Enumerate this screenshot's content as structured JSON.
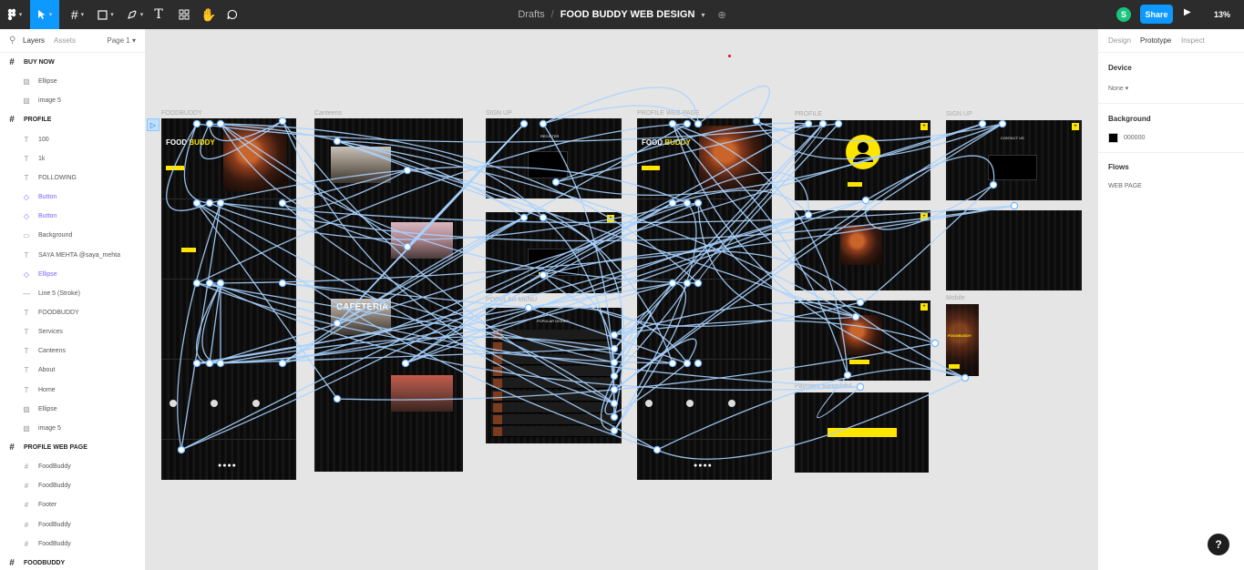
{
  "toolbar": {
    "tools": [
      {
        "name": "main-menu",
        "icon": "figma-logo-icon"
      },
      {
        "name": "move",
        "icon": "move-cursor-icon"
      },
      {
        "name": "frame",
        "icon": "frame-hash-icon"
      },
      {
        "name": "shape",
        "icon": "rectangle-icon"
      },
      {
        "name": "pen",
        "icon": "pen-icon"
      },
      {
        "name": "text",
        "icon": "text-icon"
      },
      {
        "name": "resources",
        "icon": "resources-icon"
      },
      {
        "name": "hand",
        "icon": "hand-icon"
      },
      {
        "name": "comment",
        "icon": "comment-icon"
      }
    ],
    "breadcrumb_parent": "Drafts",
    "separator": "/",
    "file_name": "FOOD BUDDY WEB DESIGN",
    "avatar_initial": "S",
    "share_label": "Share",
    "zoom": "13%"
  },
  "left_panel": {
    "tab_layers": "Layers",
    "tab_assets": "Assets",
    "page": "Page 1",
    "layers": [
      {
        "label": "BUY NOW",
        "kind": "frame"
      },
      {
        "label": "Ellipse",
        "kind": "image"
      },
      {
        "label": "image 5",
        "kind": "image"
      },
      {
        "label": "PROFILE",
        "kind": "frame"
      },
      {
        "label": "100",
        "kind": "text"
      },
      {
        "label": "1k",
        "kind": "text"
      },
      {
        "label": "FOLLOWING",
        "kind": "text"
      },
      {
        "label": "Button",
        "kind": "component"
      },
      {
        "label": "Button",
        "kind": "component"
      },
      {
        "label": "Background",
        "kind": "rect"
      },
      {
        "label": "SAYA MEHTA @saya_mehta",
        "kind": "text"
      },
      {
        "label": "Ellipse",
        "kind": "component"
      },
      {
        "label": "Line 5 (Stroke)",
        "kind": "line"
      },
      {
        "label": "FOODBUDDY",
        "kind": "text"
      },
      {
        "label": "Services",
        "kind": "text"
      },
      {
        "label": "Canteens",
        "kind": "text"
      },
      {
        "label": "About",
        "kind": "text"
      },
      {
        "label": "Home",
        "kind": "text"
      },
      {
        "label": "Ellipse",
        "kind": "image"
      },
      {
        "label": "image 5",
        "kind": "image"
      },
      {
        "label": "PROFILE WEB PAGE",
        "kind": "frame"
      },
      {
        "label": "FoodBuddy",
        "kind": "subframe"
      },
      {
        "label": "FoodBuddy",
        "kind": "subframe"
      },
      {
        "label": "Footer",
        "kind": "subframe"
      },
      {
        "label": "FoodBuddy",
        "kind": "subframe"
      },
      {
        "label": "FoodBuddy",
        "kind": "subframe"
      },
      {
        "label": "FOODBUDDY",
        "kind": "frame"
      }
    ]
  },
  "canvas": {
    "frame_labels": [
      "FOODBUDDY",
      "Canteens",
      "SIGN UP",
      "PROFILE WEB PAGE",
      "PROFILE",
      "SIGN UP",
      "POPULAR MENU",
      "Mobile",
      "Payment successful"
    ],
    "art_text": {
      "food": "FOOD",
      "buddy": "BUDDY",
      "foodbuddy_mobile": "FOODBUDDY",
      "register": "REGISTER",
      "contact": "CONTACT US",
      "popular": "POPULAR DISHES",
      "cafeteria": "CAFETERIA"
    }
  },
  "right_panel": {
    "tab_design": "Design",
    "tab_prototype": "Prototype",
    "tab_inspect": "Inspect",
    "device_heading": "Device",
    "device_value": "None",
    "background_heading": "Background",
    "background_value": "000000",
    "flows_heading": "Flows",
    "flow_name": "WEB PAGE"
  },
  "help_label": "?",
  "colors": {
    "accent": "#0d99ff",
    "toolbar": "#2c2c2c",
    "yellow": "#ffe500",
    "proto_line": "#a8d3ff"
  }
}
